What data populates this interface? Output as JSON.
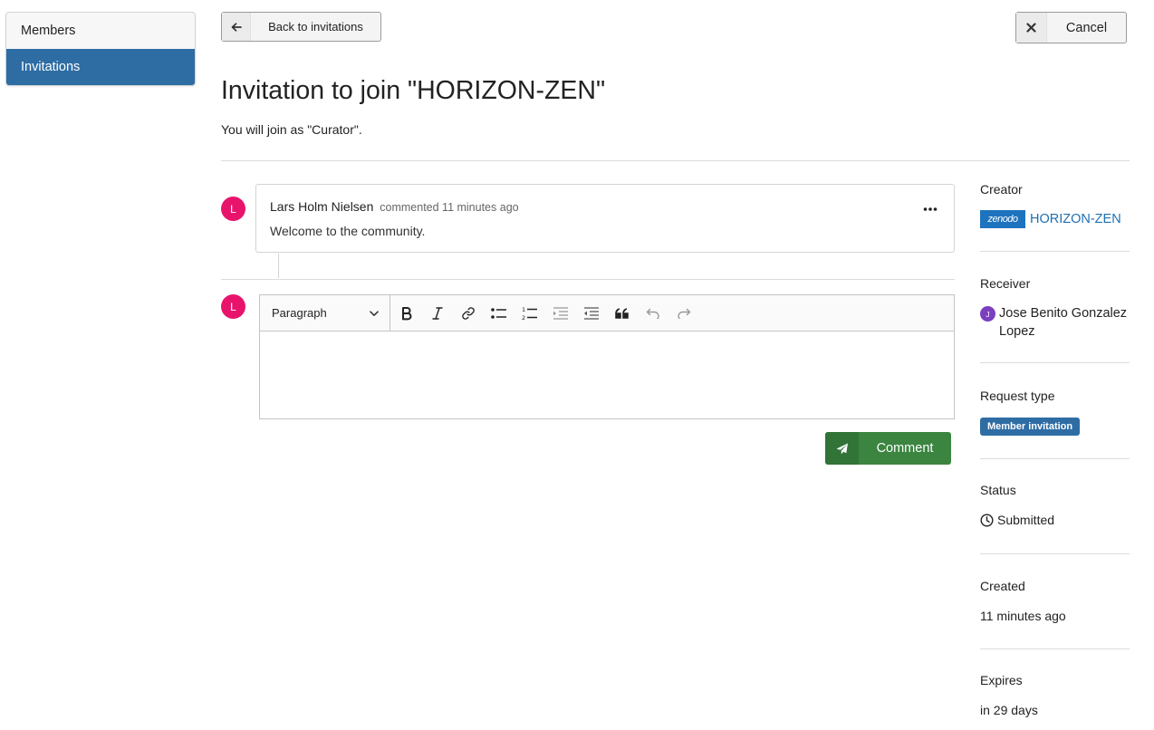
{
  "sidebar": {
    "items": [
      {
        "label": "Members"
      },
      {
        "label": "Invitations"
      }
    ]
  },
  "header": {
    "back_label": "Back to invitations",
    "cancel_label": "Cancel",
    "title": "Invitation to join \"HORIZON-ZEN\"",
    "subtitle": "You will join as \"Curator\"."
  },
  "timeline": {
    "comment": {
      "avatar_letter": "L",
      "author": "Lars Holm Nielsen",
      "meta": "commented 11 minutes ago",
      "text": "Welcome to the community."
    },
    "composer": {
      "avatar_letter": "L",
      "paragraph_select": "Paragraph",
      "submit_label": "Comment"
    }
  },
  "details": {
    "creator": {
      "label": "Creator",
      "logo_text": "zenodo",
      "name": "HORIZON-ZEN"
    },
    "receiver": {
      "label": "Receiver",
      "avatar_letter": "J",
      "name": "Jose Benito Gonzalez Lopez"
    },
    "request_type": {
      "label": "Request type",
      "badge": "Member invitation"
    },
    "status": {
      "label": "Status",
      "value": "Submitted"
    },
    "created": {
      "label": "Created",
      "value": "11 minutes ago"
    },
    "expires": {
      "label": "Expires",
      "value": "in 29 days"
    }
  },
  "colors": {
    "accent_blue": "#2e6da4",
    "comment_green": "#3b8540",
    "avatar_pink": "#e8146c",
    "link_blue": "#1f6fb2"
  }
}
